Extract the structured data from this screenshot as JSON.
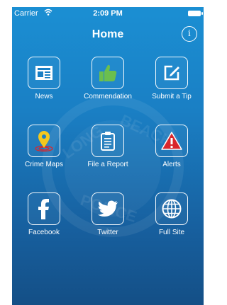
{
  "status_bar": {
    "carrier": "Carrier",
    "time": "2:09 PM"
  },
  "nav": {
    "title": "Home",
    "info_icon": "i"
  },
  "background_watermark": {
    "icon": "long-beach-police-seal",
    "words": [
      "LONG",
      "BEACH",
      "POLICE"
    ]
  },
  "tiles": [
    {
      "label": "News",
      "icon": "newspaper-icon"
    },
    {
      "label": "Commendation",
      "icon": "thumbs-up-icon"
    },
    {
      "label": "Submit a Tip",
      "icon": "edit-note-icon"
    },
    {
      "label": "Crime Maps",
      "icon": "map-pin-icon"
    },
    {
      "label": "File a Report",
      "icon": "clipboard-icon"
    },
    {
      "label": "Alerts",
      "icon": "warning-icon"
    },
    {
      "label": "Facebook",
      "icon": "facebook-icon"
    },
    {
      "label": "Twitter",
      "icon": "twitter-icon"
    },
    {
      "label": "Full Site",
      "icon": "globe-icon"
    }
  ],
  "colors": {
    "accent_green": "#6bbf4e",
    "alert_red": "#d9262c",
    "pin_yellow": "#f2c81d"
  }
}
